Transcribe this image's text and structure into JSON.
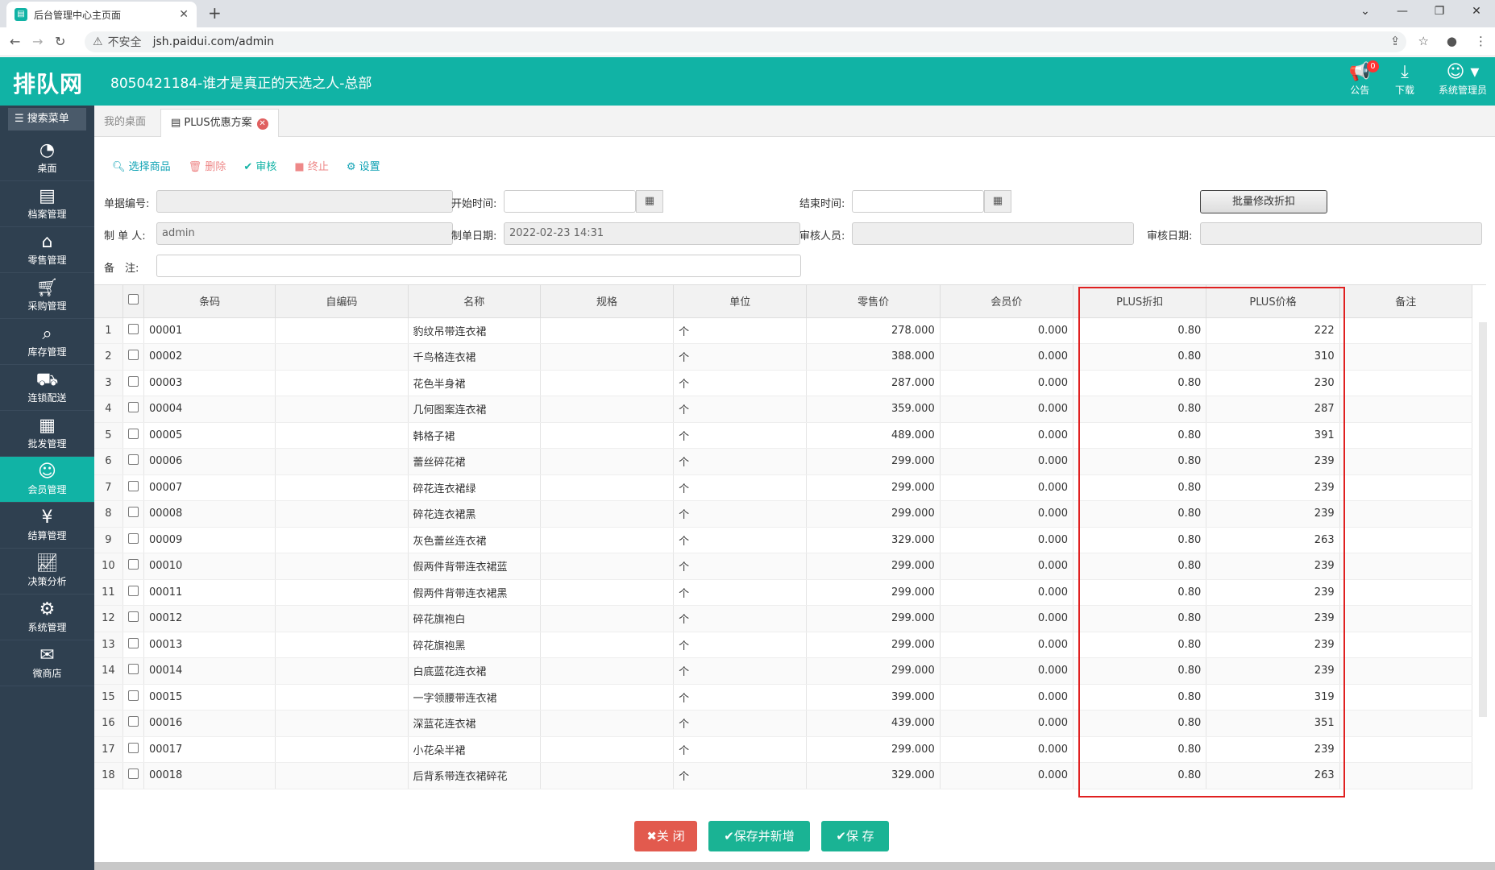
{
  "browser": {
    "tab_title": "后台管理中心主页面",
    "new_tab": "+",
    "security": "不安全",
    "url": "jsh.paidui.com/admin"
  },
  "header": {
    "logo": "排队网",
    "title": "8050421184-谁才是真正的天选之人-总部",
    "notice_label": "公告",
    "notice_count": "0",
    "download_label": "下载",
    "user_label": "系统管理员"
  },
  "sidebar": {
    "search": "搜索菜单",
    "items": [
      {
        "label": "桌面",
        "icon": "dashboard-icon"
      },
      {
        "label": "档案管理",
        "icon": "archive-icon"
      },
      {
        "label": "零售管理",
        "icon": "store-icon"
      },
      {
        "label": "采购管理",
        "icon": "cart-icon"
      },
      {
        "label": "库存管理",
        "icon": "inventory-icon"
      },
      {
        "label": "连锁配送",
        "icon": "truck-icon"
      },
      {
        "label": "批发管理",
        "icon": "wholesale-icon"
      },
      {
        "label": "会员管理",
        "icon": "member-icon"
      },
      {
        "label": "结算管理",
        "icon": "settlement-icon"
      },
      {
        "label": "决策分析",
        "icon": "analytics-icon"
      },
      {
        "label": "系统管理",
        "icon": "settings-icon"
      },
      {
        "label": "微商店",
        "icon": "shop-icon"
      }
    ]
  },
  "tabs": {
    "desk": "我的桌面",
    "current": "PLUS优惠方案"
  },
  "toolbar": {
    "select": "选择商品",
    "delete": "删除",
    "audit": "审核",
    "stop": "终止",
    "settings": "设置"
  },
  "form": {
    "doc_no_label": "单据编号:",
    "start_label": "开始时间:",
    "end_label": "结束时间:",
    "batch_btn": "批量修改折扣",
    "maker_label": "制 单 人:",
    "maker_value": "admin",
    "date_label": "制单日期:",
    "date_value": "2022-02-23 14:31",
    "auditor_label": "审核人员:",
    "audit_date_label": "审核日期:",
    "note_label": "备　注:"
  },
  "grid": {
    "headers": [
      "条码",
      "自编码",
      "名称",
      "规格",
      "单位",
      "零售价",
      "会员价",
      "PLUS折扣",
      "PLUS价格",
      "备注"
    ],
    "rows": [
      [
        "1",
        "00001",
        "",
        "豹纹吊带连衣裙",
        "",
        "个",
        "278.000",
        "0.000",
        "0.80",
        "222",
        ""
      ],
      [
        "2",
        "00002",
        "",
        "千鸟格连衣裙",
        "",
        "个",
        "388.000",
        "0.000",
        "0.80",
        "310",
        ""
      ],
      [
        "3",
        "00003",
        "",
        "花色半身裙",
        "",
        "个",
        "287.000",
        "0.000",
        "0.80",
        "230",
        ""
      ],
      [
        "4",
        "00004",
        "",
        "几何图案连衣裙",
        "",
        "个",
        "359.000",
        "0.000",
        "0.80",
        "287",
        ""
      ],
      [
        "5",
        "00005",
        "",
        "韩格子裙",
        "",
        "个",
        "489.000",
        "0.000",
        "0.80",
        "391",
        ""
      ],
      [
        "6",
        "00006",
        "",
        "蕾丝碎花裙",
        "",
        "个",
        "299.000",
        "0.000",
        "0.80",
        "239",
        ""
      ],
      [
        "7",
        "00007",
        "",
        "碎花连衣裙绿",
        "",
        "个",
        "299.000",
        "0.000",
        "0.80",
        "239",
        ""
      ],
      [
        "8",
        "00008",
        "",
        "碎花连衣裙黑",
        "",
        "个",
        "299.000",
        "0.000",
        "0.80",
        "239",
        ""
      ],
      [
        "9",
        "00009",
        "",
        "灰色蕾丝连衣裙",
        "",
        "个",
        "329.000",
        "0.000",
        "0.80",
        "263",
        ""
      ],
      [
        "10",
        "00010",
        "",
        "假两件背带连衣裙蓝",
        "",
        "个",
        "299.000",
        "0.000",
        "0.80",
        "239",
        ""
      ],
      [
        "11",
        "00011",
        "",
        "假两件背带连衣裙黑",
        "",
        "个",
        "299.000",
        "0.000",
        "0.80",
        "239",
        ""
      ],
      [
        "12",
        "00012",
        "",
        "碎花旗袍白",
        "",
        "个",
        "299.000",
        "0.000",
        "0.80",
        "239",
        ""
      ],
      [
        "13",
        "00013",
        "",
        "碎花旗袍黑",
        "",
        "个",
        "299.000",
        "0.000",
        "0.80",
        "239",
        ""
      ],
      [
        "14",
        "00014",
        "",
        "白底蓝花连衣裙",
        "",
        "个",
        "299.000",
        "0.000",
        "0.80",
        "239",
        ""
      ],
      [
        "15",
        "00015",
        "",
        "一字领腰带连衣裙",
        "",
        "个",
        "399.000",
        "0.000",
        "0.80",
        "319",
        ""
      ],
      [
        "16",
        "00016",
        "",
        "深蓝花连衣裙",
        "",
        "个",
        "439.000",
        "0.000",
        "0.80",
        "351",
        ""
      ],
      [
        "17",
        "00017",
        "",
        "小花朵半裙",
        "",
        "个",
        "299.000",
        "0.000",
        "0.80",
        "239",
        ""
      ],
      [
        "18",
        "00018",
        "",
        "后背系带连衣裙碎花",
        "",
        "个",
        "329.000",
        "0.000",
        "0.80",
        "263",
        ""
      ]
    ]
  },
  "buttons": {
    "close": "✖关 闭",
    "save_new": "✔保存并新增",
    "save": "✔保 存"
  },
  "colors": {
    "accent": "#11b3a5",
    "sidebar": "#2f4050",
    "highlight": "#e02020"
  }
}
